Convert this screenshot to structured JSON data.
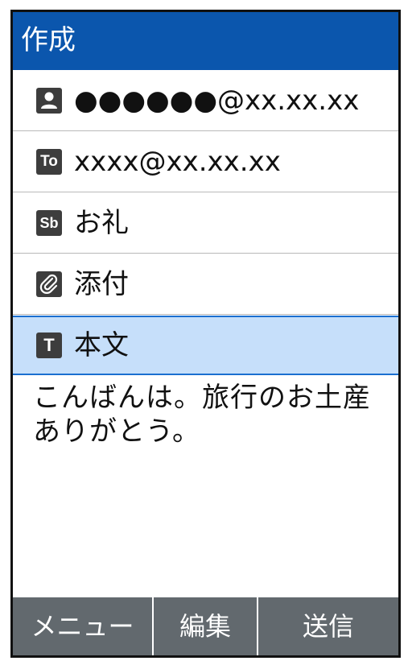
{
  "header": {
    "title": "作成"
  },
  "fields": {
    "from": {
      "icon": "person-icon",
      "value": "●●●●●●@xx.xx.xx"
    },
    "to": {
      "icon": "to-icon",
      "icon_text": "To",
      "value": "xxxx@xx.xx.xx"
    },
    "subject": {
      "icon": "subject-icon",
      "icon_text": "Sb",
      "value": "お礼"
    },
    "attachment": {
      "icon": "paperclip-icon",
      "value": "添付"
    },
    "body_field": {
      "icon": "text-icon",
      "icon_text": "T",
      "value": "本文"
    }
  },
  "body": {
    "text": "こんばんは。旅行のお土産ありがとう。"
  },
  "softkeys": {
    "menu": "メニュー",
    "edit": "編集",
    "send": "送信"
  },
  "colors": {
    "header_bg": "#0b56ad",
    "selected_bg": "#c6dffa",
    "selected_border": "#1a6fd0",
    "softkey_bg": "#62696e",
    "icon_bg": "#3d3d3d"
  }
}
